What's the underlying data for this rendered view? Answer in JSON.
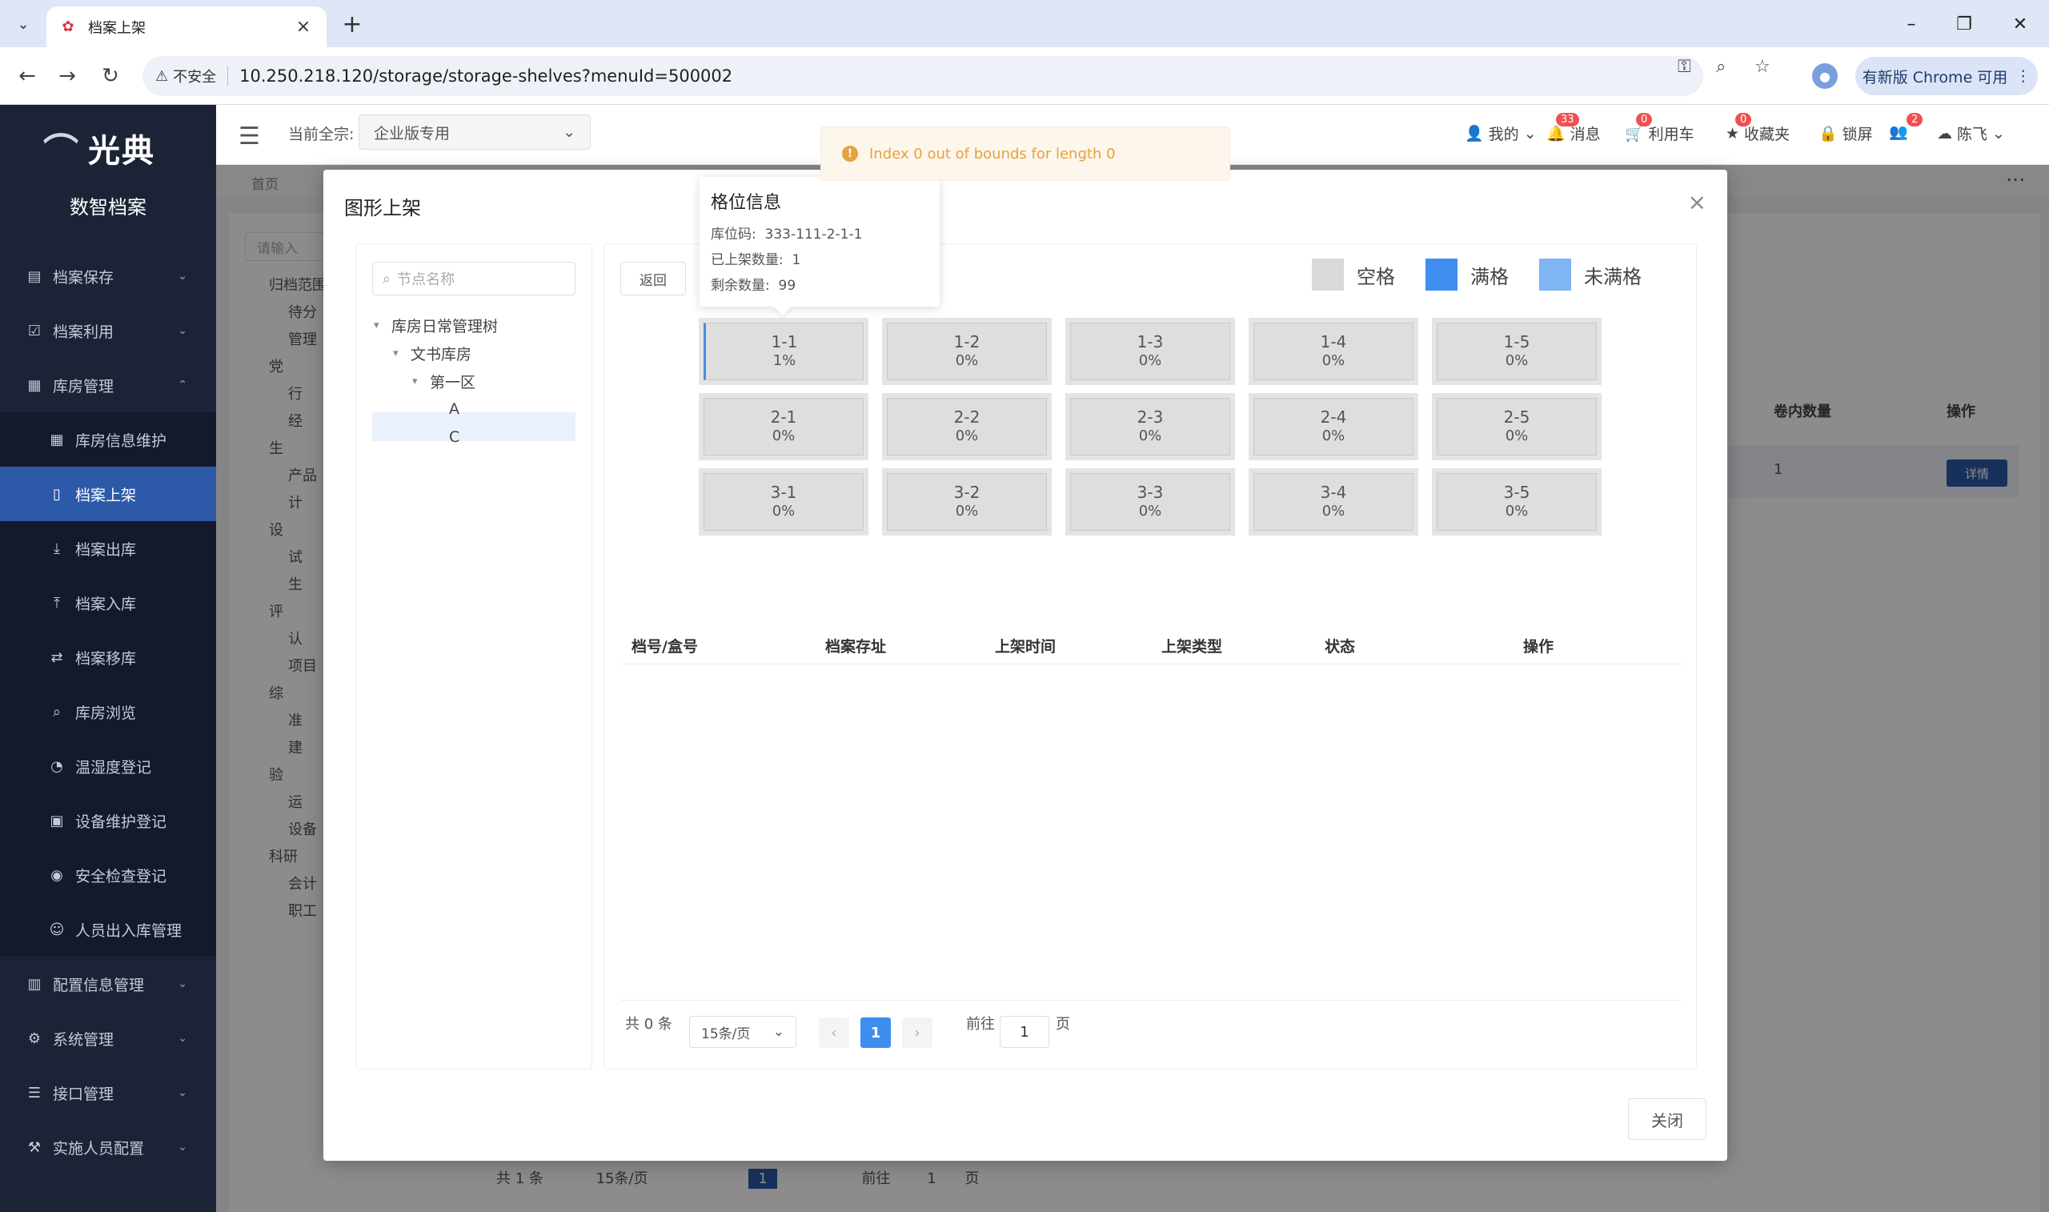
{
  "browser": {
    "tab_title": "档案上架",
    "url": "10.250.218.120/storage/storage-shelves?menuId=500002",
    "insecure_label": "不安全",
    "update_label": "有新版 Chrome 可用"
  },
  "app": {
    "logo_text": "光典",
    "logo_sub": "数智档案",
    "current_label": "当前全宗:",
    "current_value": "企业版专用",
    "breadcrumb": "首页"
  },
  "sidebar": {
    "items": [
      {
        "label": "档案保存",
        "icon": "archive-icon",
        "type": "group"
      },
      {
        "label": "档案利用",
        "icon": "check-icon",
        "type": "group"
      },
      {
        "label": "库房管理",
        "icon": "building-icon",
        "type": "group-open"
      },
      {
        "label": "库房信息维护",
        "icon": "building-icon",
        "type": "sub"
      },
      {
        "label": "档案上架",
        "icon": "shelf-icon",
        "type": "sub-active"
      },
      {
        "label": "档案出库",
        "icon": "download-icon",
        "type": "sub"
      },
      {
        "label": "档案入库",
        "icon": "upload-icon",
        "type": "sub"
      },
      {
        "label": "档案移库",
        "icon": "move-icon",
        "type": "sub"
      },
      {
        "label": "库房浏览",
        "icon": "search-icon",
        "type": "sub"
      },
      {
        "label": "温湿度登记",
        "icon": "gauge-icon",
        "type": "sub"
      },
      {
        "label": "设备维护登记",
        "icon": "device-icon",
        "type": "sub"
      },
      {
        "label": "安全检查登记",
        "icon": "eye-icon",
        "type": "sub"
      },
      {
        "label": "人员出入库管理",
        "icon": "user-icon",
        "type": "sub"
      },
      {
        "label": "配置信息管理",
        "icon": "config-icon",
        "type": "group"
      },
      {
        "label": "系统管理",
        "icon": "gear-icon",
        "type": "group"
      },
      {
        "label": "接口管理",
        "icon": "database-icon",
        "type": "group"
      },
      {
        "label": "实施人员配置",
        "icon": "wrench-icon",
        "type": "group"
      }
    ]
  },
  "topbar": {
    "mine": "我的",
    "messages": "消息",
    "messages_badge": "33",
    "cart": "利用车",
    "cart_badge": "0",
    "favorites": "收藏夹",
    "favorites_badge": "0",
    "lock": "锁屏",
    "user_badge": "2",
    "username": "陈飞"
  },
  "background": {
    "search_placeholder": "请输入",
    "tree": [
      "归档范围",
      "待分",
      "管理",
      "党",
      "行",
      "经",
      "生",
      "产品",
      "计",
      "设",
      "试",
      "生",
      "评",
      "认",
      "项目",
      "综",
      "准",
      "建",
      "验",
      "运",
      "设备",
      "科研",
      "会计",
      "职工"
    ],
    "col_volume": "卷内数量",
    "col_ops": "操作",
    "row_value": "1",
    "detail_btn": "详情",
    "total": "共 1 条",
    "page_size": "15条/页",
    "page": "1",
    "goto": "前往",
    "goto_value": "1",
    "page_unit": "页"
  },
  "dialog": {
    "title": "图形上架",
    "tree_placeholder": "节点名称",
    "tree": [
      {
        "label": "库房日常管理树",
        "level": 0,
        "expanded": true
      },
      {
        "label": "文书库房",
        "level": 1,
        "expanded": true
      },
      {
        "label": "第一区",
        "level": 2,
        "expanded": true
      },
      {
        "label": "A",
        "level": 3
      },
      {
        "label": "C",
        "level": 3,
        "selected": true
      }
    ],
    "back_label": "返回",
    "legend": [
      {
        "label": "空格",
        "color": "#d9d9d9"
      },
      {
        "label": "满格",
        "color": "#3f8ef0"
      },
      {
        "label": "未满格",
        "color": "#7fb4f5"
      }
    ],
    "cells": [
      {
        "label": "1-1",
        "pct": "1%"
      },
      {
        "label": "1-2",
        "pct": "0%"
      },
      {
        "label": "1-3",
        "pct": "0%"
      },
      {
        "label": "1-4",
        "pct": "0%"
      },
      {
        "label": "1-5",
        "pct": "0%"
      },
      {
        "label": "2-1",
        "pct": "0%"
      },
      {
        "label": "2-2",
        "pct": "0%"
      },
      {
        "label": "2-3",
        "pct": "0%"
      },
      {
        "label": "2-4",
        "pct": "0%"
      },
      {
        "label": "2-5",
        "pct": "0%"
      },
      {
        "label": "3-1",
        "pct": "0%"
      },
      {
        "label": "3-2",
        "pct": "0%"
      },
      {
        "label": "3-3",
        "pct": "0%"
      },
      {
        "label": "3-4",
        "pct": "0%"
      },
      {
        "label": "3-5",
        "pct": "0%"
      }
    ],
    "columns": [
      "档号/盒号",
      "档案存址",
      "上架时间",
      "上架类型",
      "状态",
      "操作"
    ],
    "pagination": {
      "total": "共 0 条",
      "page_size": "15条/页",
      "prev": "‹",
      "current": "1",
      "next": "›",
      "goto": "前往",
      "goto_value": "1",
      "page_unit": "页"
    },
    "close_label": "关闭"
  },
  "tooltip": {
    "title": "格位信息",
    "code_label": "库位码:",
    "code_value": "333-111-2-1-1",
    "shelved_label": "已上架数量:",
    "shelved_value": "1",
    "remaining_label": "剩余数量:",
    "remaining_value": "99"
  },
  "toast": {
    "message": "Index 0 out of bounds for length 0"
  }
}
